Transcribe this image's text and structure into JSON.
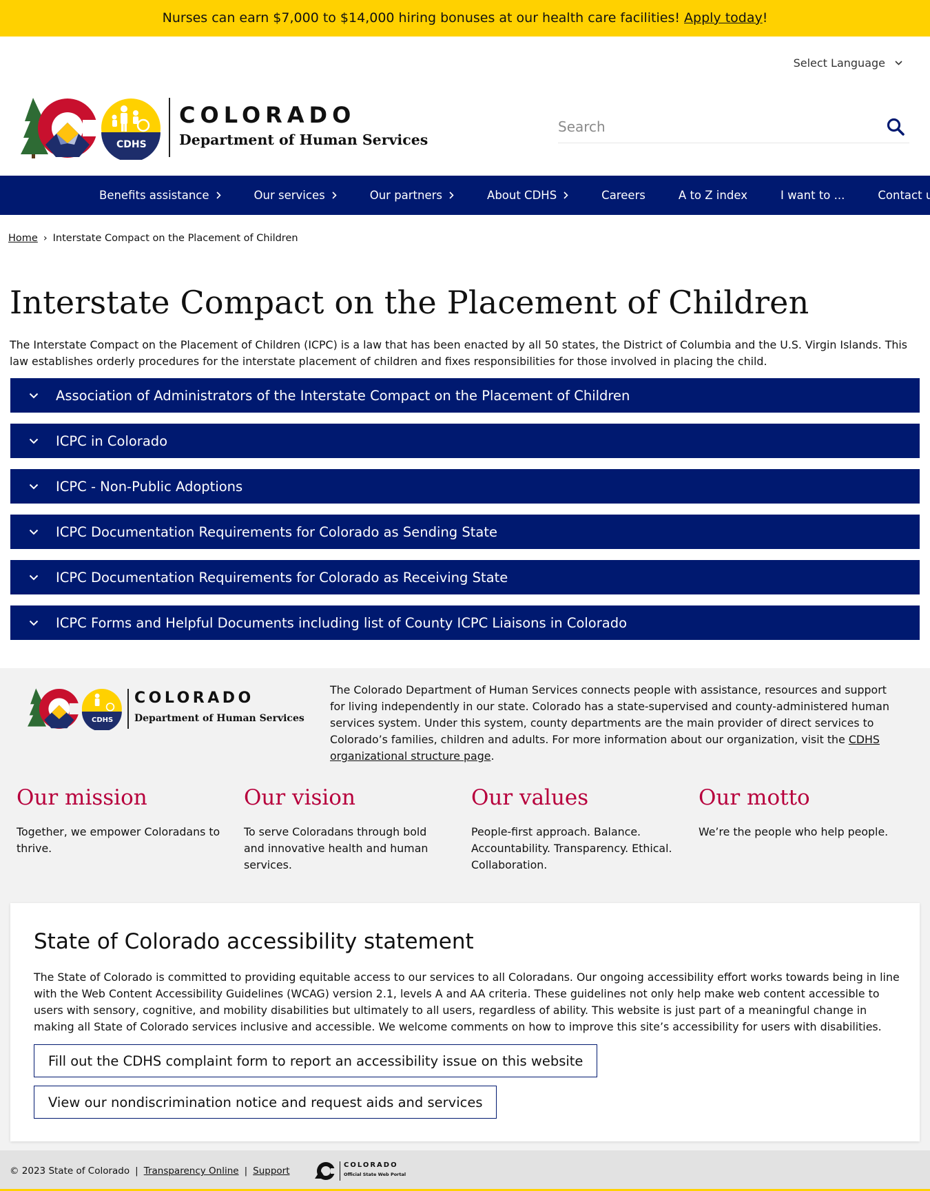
{
  "colors": {
    "banner": "#ffd100",
    "nav": "#001970",
    "accent_red": "#b7003c",
    "accordion": "#001970"
  },
  "banner": {
    "text": "Nurses can earn $7,000 to $14,000 hiring bonuses at our health care facilities! ",
    "link": "Apply today",
    "suffix": "!"
  },
  "language": {
    "label": "Select Language",
    "icon": "chevron-down-icon"
  },
  "logo": {
    "word": "COLORADO",
    "dept": "Department of Human Services",
    "badge": "CDHS"
  },
  "search": {
    "placeholder": "Search",
    "icon": "search-icon"
  },
  "nav": {
    "items": [
      {
        "label": "Benefits assistance",
        "has_submenu": true
      },
      {
        "label": "Our services",
        "has_submenu": true
      },
      {
        "label": "Our partners",
        "has_submenu": true
      },
      {
        "label": "About CDHS",
        "has_submenu": true
      },
      {
        "label": "Careers",
        "has_submenu": false
      },
      {
        "label": "A to Z index",
        "has_submenu": false
      },
      {
        "label": "I want to ...",
        "has_submenu": false
      },
      {
        "label": "Contact us",
        "has_submenu": false
      }
    ]
  },
  "breadcrumb": {
    "home": "Home",
    "separator": "›",
    "current": "Interstate Compact on the Placement of Children"
  },
  "page": {
    "title": "Interstate Compact on the Placement of Children",
    "intro": "The Interstate Compact on the Placement of Children (ICPC) is a law that has been enacted by all 50 states, the District of Columbia and the U.S. Virgin Islands. This law establishes orderly procedures for the interstate placement of children and fixes responsibilities for those involved in placing the child."
  },
  "accordion": [
    "Association of Administrators of the Interstate Compact on the Placement of Children",
    "ICPC in Colorado",
    "ICPC - Non-Public Adoptions",
    "ICPC Documentation Requirements for Colorado as Sending State",
    "ICPC Documentation Requirements for Colorado as Receiving State",
    "ICPC Forms and Helpful Documents including list of County ICPC Liaisons in Colorado"
  ],
  "footer": {
    "about_text": "The Colorado Department of Human Services connects people with assistance, resources and support for living independently in our state. Colorado has a state-supervised and county-administered human services system. Under this system, county departments are the main provider of direct services to Colorado’s families, children and adults. For more information about our organization, visit the ",
    "about_link": "CDHS organizational structure page",
    "about_suffix": ".",
    "pillars": [
      {
        "title": "Our mission",
        "text": "Together, we empower Coloradans to thrive."
      },
      {
        "title": "Our vision",
        "text": "To serve Coloradans through bold and innovative health and human services."
      },
      {
        "title": "Our values",
        "text": "People-first approach. Balance. Accountability. Transparency. Ethical. Collaboration."
      },
      {
        "title": "Our motto",
        "text": "We’re the people who help people."
      }
    ]
  },
  "accessibility": {
    "title": "State of Colorado accessibility statement",
    "text": "The State of Colorado is committed to providing equitable access to our services to all Coloradans. Our ongoing accessibility effort works towards being in line with the Web Content Accessibility Guidelines (WCAG) version 2.1, levels A and AA criteria. These guidelines not only help make web content accessible to users with sensory, cognitive, and mobility disabilities but ultimately to all users, regardless of ability. This website is just part of a meaningful change in making all State of Colorado services inclusive and accessible. We welcome comments on how to improve this site’s accessibility for users with disabilities.",
    "button_complaint": "Fill out the CDHS complaint form to report an accessibility issue on this website",
    "button_notice": "View our nondiscrimination notice and request aids and services"
  },
  "bottom_bar": {
    "copyright": "© 2023 State of Colorado",
    "sep": "|",
    "link_transparency": "Transparency Online",
    "link_support": "Support",
    "portal_word": "COLORADO",
    "portal_sub": "Official State Web Portal"
  }
}
